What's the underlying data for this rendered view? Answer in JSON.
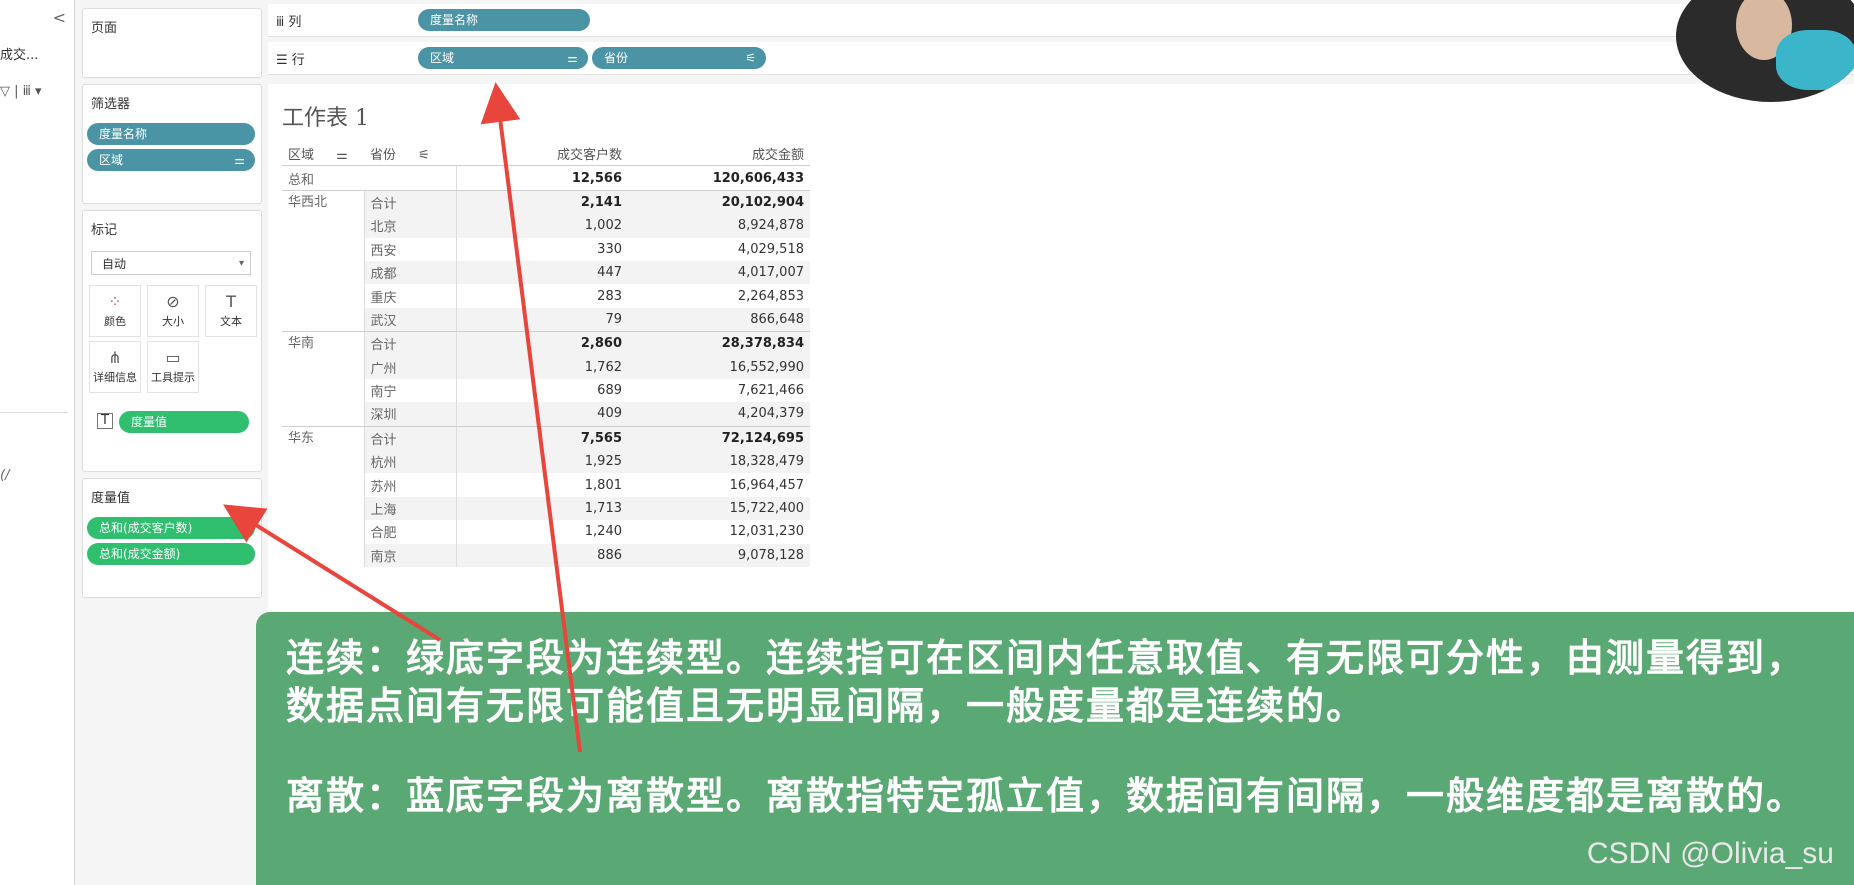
{
  "left_pane": {
    "collapse": "<",
    "source_fragment": "成交...",
    "tools_fragment": "▽ | ⅲ ▾",
    "fragment2": "(/"
  },
  "pages_card": {
    "title": "页面"
  },
  "filters_card": {
    "title": "筛选器",
    "pills": [
      {
        "label": "度量名称"
      },
      {
        "label": "区域",
        "icon": "⚌"
      }
    ]
  },
  "marks_card": {
    "title": "标记",
    "mark_type": "自动",
    "buttons": [
      {
        "label": "颜色",
        "icon": "⁘"
      },
      {
        "label": "大小",
        "icon": "⊘"
      },
      {
        "label": "文本",
        "icon": "T"
      },
      {
        "label": "详细信息",
        "icon": "⋔"
      },
      {
        "label": "工具提示",
        "icon": "▭"
      }
    ],
    "text_pill": "度量值"
  },
  "measure_values_card": {
    "title": "度量值",
    "pills": [
      "总和(成交客户数)",
      "总和(成交金额)"
    ]
  },
  "shelves": {
    "columns": {
      "label": "ⅲ 列",
      "pills": [
        {
          "label": "度量名称"
        }
      ]
    },
    "rows": {
      "label": "☰ 行",
      "pills": [
        {
          "label": "区域",
          "icon": "⚌"
        },
        {
          "label": "省份",
          "icon": "⚟"
        }
      ]
    }
  },
  "sheet": {
    "title": "工作表 1",
    "headers": [
      "区域",
      "省份",
      "成交客户数",
      "成交金额"
    ],
    "grand_total": {
      "label": "总和",
      "clients": "12,566",
      "amount": "120,606,433"
    },
    "regions": [
      {
        "name": "华西北",
        "rows": [
          {
            "prov": "合计",
            "clients": "2,141",
            "amount": "20,102,904",
            "subtotal": true
          },
          {
            "prov": "北京",
            "clients": "1,002",
            "amount": "8,924,878"
          },
          {
            "prov": "西安",
            "clients": "330",
            "amount": "4,029,518"
          },
          {
            "prov": "成都",
            "clients": "447",
            "amount": "4,017,007"
          },
          {
            "prov": "重庆",
            "clients": "283",
            "amount": "2,264,853"
          },
          {
            "prov": "武汉",
            "clients": "79",
            "amount": "866,648"
          }
        ]
      },
      {
        "name": "华南",
        "rows": [
          {
            "prov": "合计",
            "clients": "2,860",
            "amount": "28,378,834",
            "subtotal": true
          },
          {
            "prov": "广州",
            "clients": "1,762",
            "amount": "16,552,990"
          },
          {
            "prov": "南宁",
            "clients": "689",
            "amount": "7,621,466"
          },
          {
            "prov": "深圳",
            "clients": "409",
            "amount": "4,204,379"
          }
        ]
      },
      {
        "name": "华东",
        "rows": [
          {
            "prov": "合计",
            "clients": "7,565",
            "amount": "72,124,695",
            "subtotal": true
          },
          {
            "prov": "杭州",
            "clients": "1,925",
            "amount": "18,328,479"
          },
          {
            "prov": "苏州",
            "clients": "1,801",
            "amount": "16,964,457"
          },
          {
            "prov": "上海",
            "clients": "1,713",
            "amount": "15,722,400"
          },
          {
            "prov": "合肥",
            "clients": "1,240",
            "amount": "12,031,230"
          },
          {
            "prov": "南京",
            "clients": "886",
            "amount": "9,078,128"
          }
        ]
      }
    ]
  },
  "note": {
    "continuous": "连续：绿底字段为连续型。连续指可在区间内任意取值、有无限可分性，由测量得到，数据点间有无限可能值且无明显间隔，一般度量都是连续的。",
    "discrete": "离散：蓝底字段为离散型。离散指特定孤立值，数据间有间隔，一般维度都是离散的。"
  },
  "watermark": "CSDN @Olivia_su",
  "colors": {
    "discrete_pill": "#4b94a6",
    "continuous_pill": "#2fbf6f",
    "note_bg": "#5aa873",
    "arrow": "#e8453c"
  }
}
